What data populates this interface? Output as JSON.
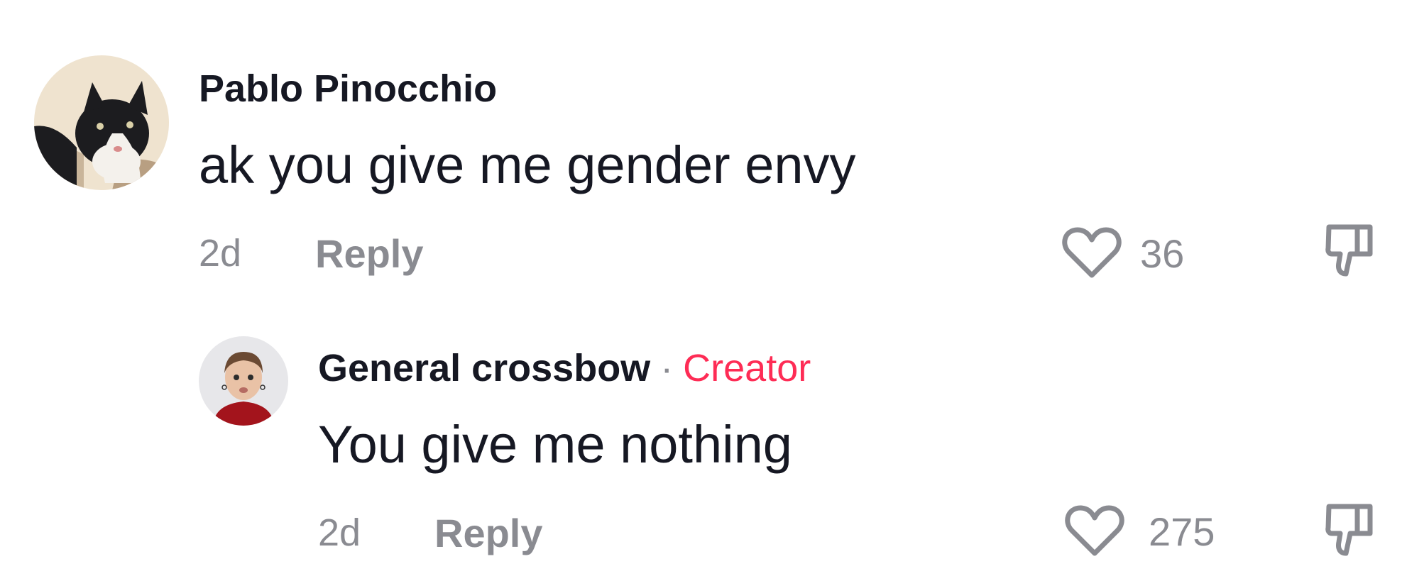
{
  "comments": [
    {
      "author": "Pablo Pinocchio",
      "badge": "",
      "text": "ak you give me gender envy",
      "time": "2d",
      "reply_label": "Reply",
      "likes": "36",
      "avatar_icon": "cat-avatar",
      "like_icon": "heart-outline-icon",
      "dislike_icon": "thumbs-down-icon"
    },
    {
      "author": "General crossbow",
      "separator": "·",
      "badge": "Creator",
      "text": "You give me nothing",
      "time": "2d",
      "reply_label": "Reply",
      "likes": "275",
      "avatar_icon": "person-avatar",
      "like_icon": "heart-outline-icon",
      "dislike_icon": "thumbs-down-icon"
    }
  ],
  "colors": {
    "text": "#161823",
    "muted": "#8a8b91",
    "creator_badge": "#fe2c55"
  }
}
